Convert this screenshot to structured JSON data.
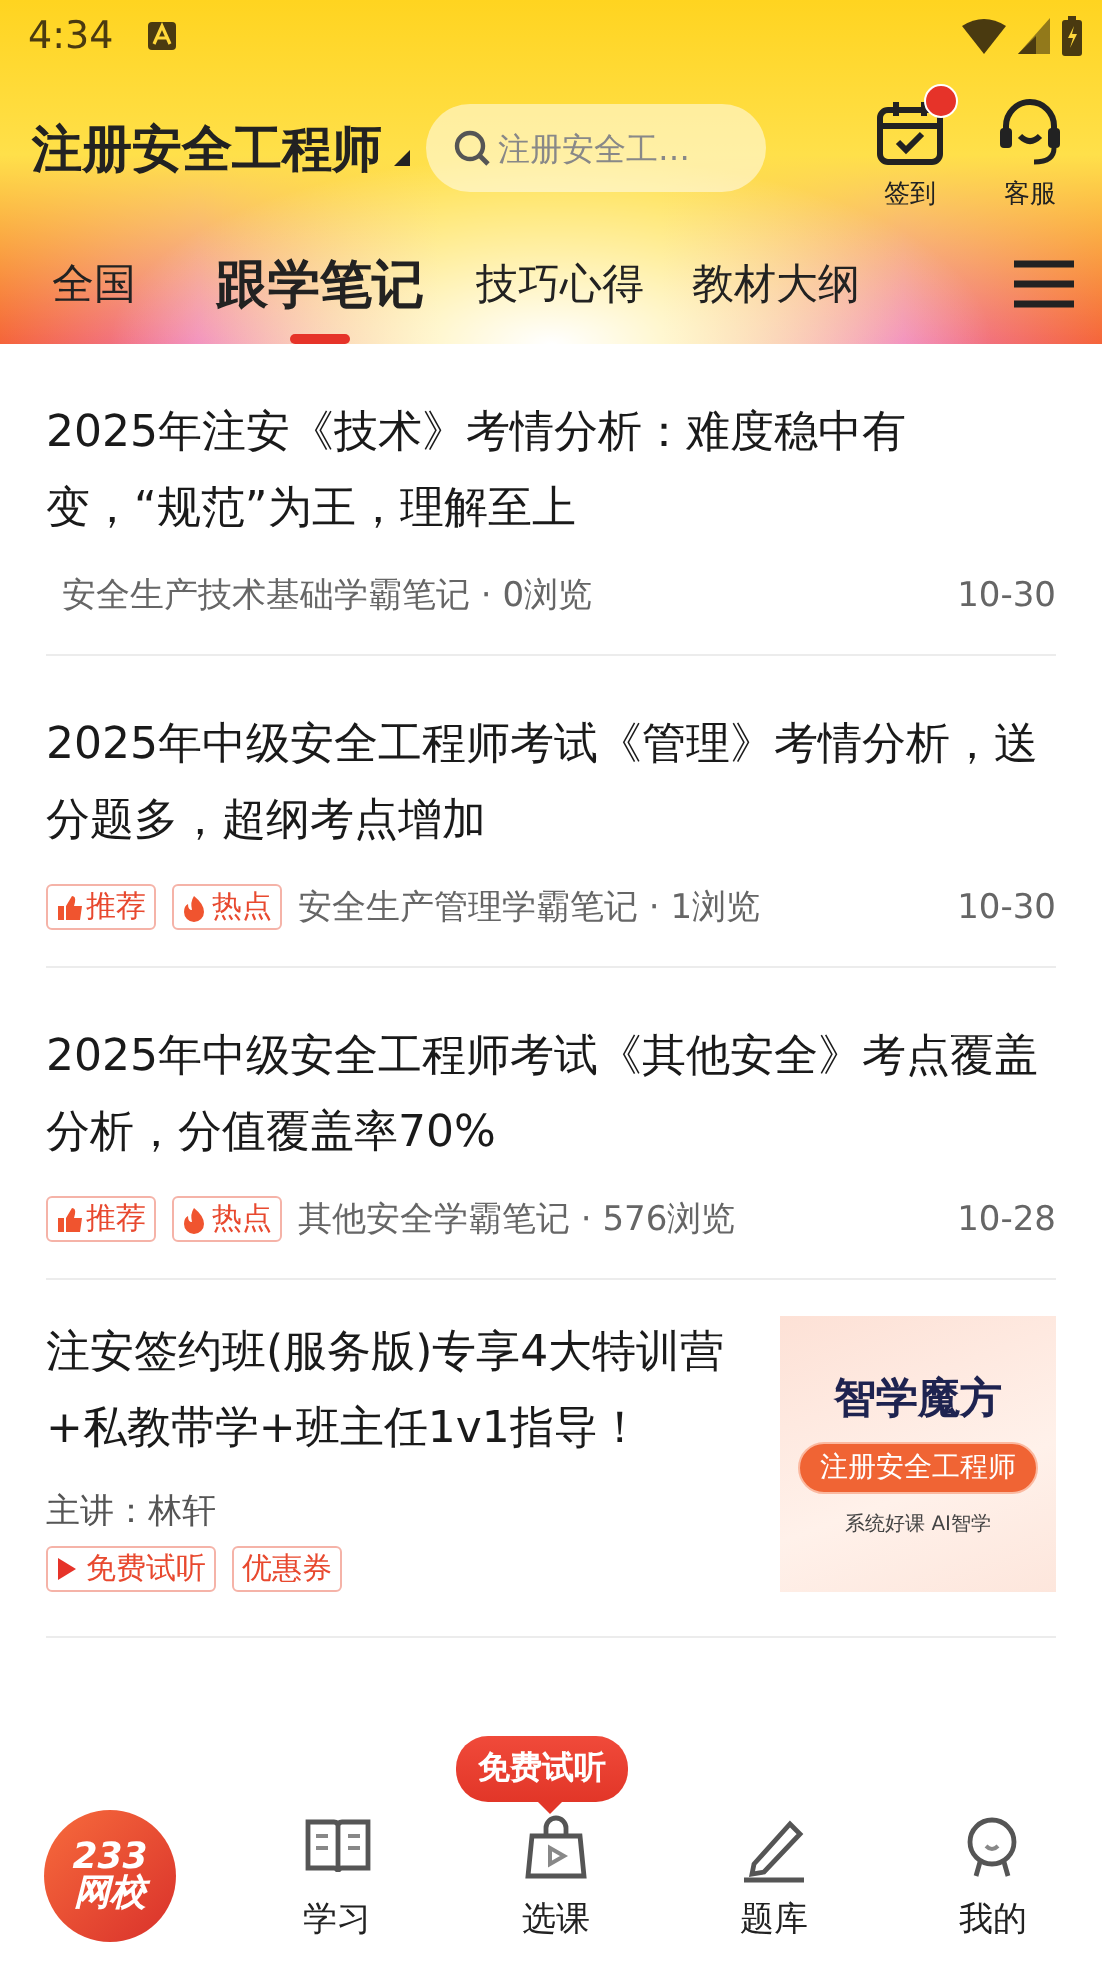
{
  "status_bar": {
    "time": "4:34"
  },
  "header": {
    "title": "注册安全工程师",
    "search": {
      "placeholder": "注册安全工…"
    },
    "actions": [
      {
        "kind": "checkin",
        "label": "签到",
        "notification": true
      },
      {
        "kind": "service",
        "label": "客服",
        "notification": false
      }
    ]
  },
  "tabs": [
    {
      "label": "全国",
      "selected": false
    },
    {
      "label": "跟学笔记",
      "selected": true
    },
    {
      "label": "技巧心得",
      "selected": false
    },
    {
      "label": "教材大纲",
      "selected": false
    }
  ],
  "feed": [
    {
      "kind": "article",
      "title": "2025年注安《技术》考情分析：难度稳中有变，“规范”为王，理解至上",
      "source": "安全生产技术基础学霸笔记 · 0浏览",
      "date": "10-30"
    },
    {
      "kind": "article",
      "title": "2025年中级安全工程师考试《管理》考情分析，送分题多，超纲考点增加",
      "tags": [
        {
          "kind": "recommend",
          "label": "推荐"
        },
        {
          "kind": "hot",
          "label": "热点"
        }
      ],
      "source": "安全生产管理学霸笔记 · 1浏览",
      "date": "10-30"
    },
    {
      "kind": "article",
      "title": "2025年中级安全工程师考试《其他安全》考点覆盖分析，分值覆盖率70%",
      "tags": [
        {
          "kind": "recommend",
          "label": "推荐"
        },
        {
          "kind": "hot",
          "label": "热点"
        }
      ],
      "source": "其他安全学霸笔记 · 576浏览",
      "date": "10-28"
    },
    {
      "kind": "course",
      "title": "注安签约班(服务版)专享4大特训营+私教带学+班主任1v1指导！",
      "teacher": "主讲：林轩",
      "tags": [
        {
          "kind": "trial",
          "label": "免费试听"
        },
        {
          "kind": "coupon",
          "label": "优惠券"
        }
      ],
      "cover": {
        "title": "智学魔方",
        "badge": "注册安全工程师",
        "subtitle": "系统好课 AI智学"
      }
    }
  ],
  "promo_bubble": "免费试听",
  "bottom_nav": {
    "logo": [
      "233",
      "网校"
    ],
    "items": [
      {
        "kind": "study",
        "label": "学习"
      },
      {
        "kind": "courses",
        "label": "选课"
      },
      {
        "kind": "questions",
        "label": "题库"
      },
      {
        "kind": "me",
        "label": "我的"
      }
    ]
  }
}
